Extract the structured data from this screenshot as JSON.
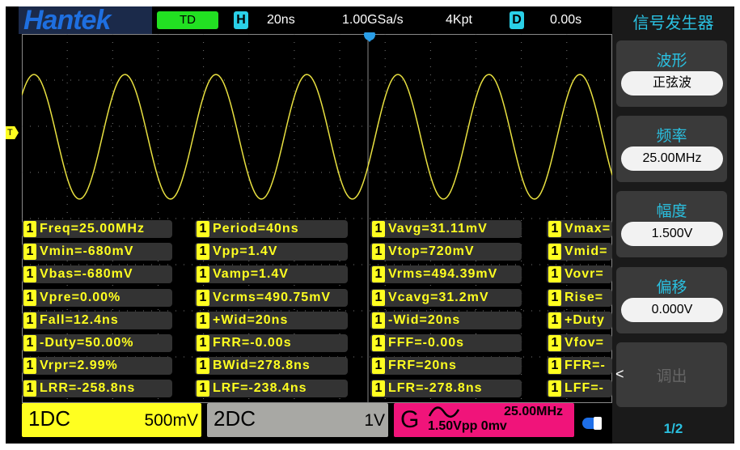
{
  "header": {
    "logo": "Hantek",
    "mode": "TD",
    "h_icon": "H",
    "timebase": "20ns",
    "sample_rate": "1.00GSa/s",
    "memory_depth": "4Kpt",
    "d_icon": "D",
    "delay": "0.00s"
  },
  "panel": {
    "title": "信号发生器",
    "items": [
      {
        "label": "波形",
        "value": "正弦波"
      },
      {
        "label": "频率",
        "value": "25.00MHz"
      },
      {
        "label": "幅度",
        "value": "1.500V"
      },
      {
        "label": "偏移",
        "value": "0.000V"
      },
      {
        "label": "调出"
      }
    ],
    "page": "1/2",
    "back_arrow": "<"
  },
  "trigger_marker": "T",
  "measurements": [
    [
      "Freq=25.00MHz",
      "Vmin=-680mV",
      "Vbas=-680mV",
      "Vpre=0.00%",
      "Fall=12.4ns",
      "-Duty=50.00%",
      "Vrpr=2.99%",
      "LRR=-258.8ns"
    ],
    [
      "Period=40ns",
      "Vpp=1.4V",
      "Vamp=1.4V",
      "Vcrms=490.75mV",
      "+Wid=20ns",
      "FRR=-0.00s",
      "BWid=278.8ns",
      "LRF=-238.4ns"
    ],
    [
      "Vavg=31.11mV",
      "Vtop=720mV",
      "Vrms=494.39mV",
      "Vcavg=31.2mV",
      "-Wid=20ns",
      "FFF=-0.00s",
      "FRF=20ns",
      "LFR=-278.8ns"
    ],
    [
      "Vmax=",
      "Vmid=",
      "Vovr=",
      "Rise=",
      "+Duty",
      "Vfov=",
      "FFR=-",
      "LFF=-"
    ]
  ],
  "channel_badge": "1",
  "channels": {
    "ch1": {
      "label": "1DC",
      "scale": "500mV",
      "color": "#ffff20"
    },
    "ch2": {
      "label": "2DC",
      "scale": "1V",
      "color": "#a8a8a4"
    },
    "gen": {
      "label": "G",
      "freq": "25.00MHz",
      "amp_offset": "1.50Vpp 0mv",
      "color": "#f0147a"
    }
  },
  "colors": {
    "trace": "#e8e040",
    "accent": "#2ac0e0"
  }
}
